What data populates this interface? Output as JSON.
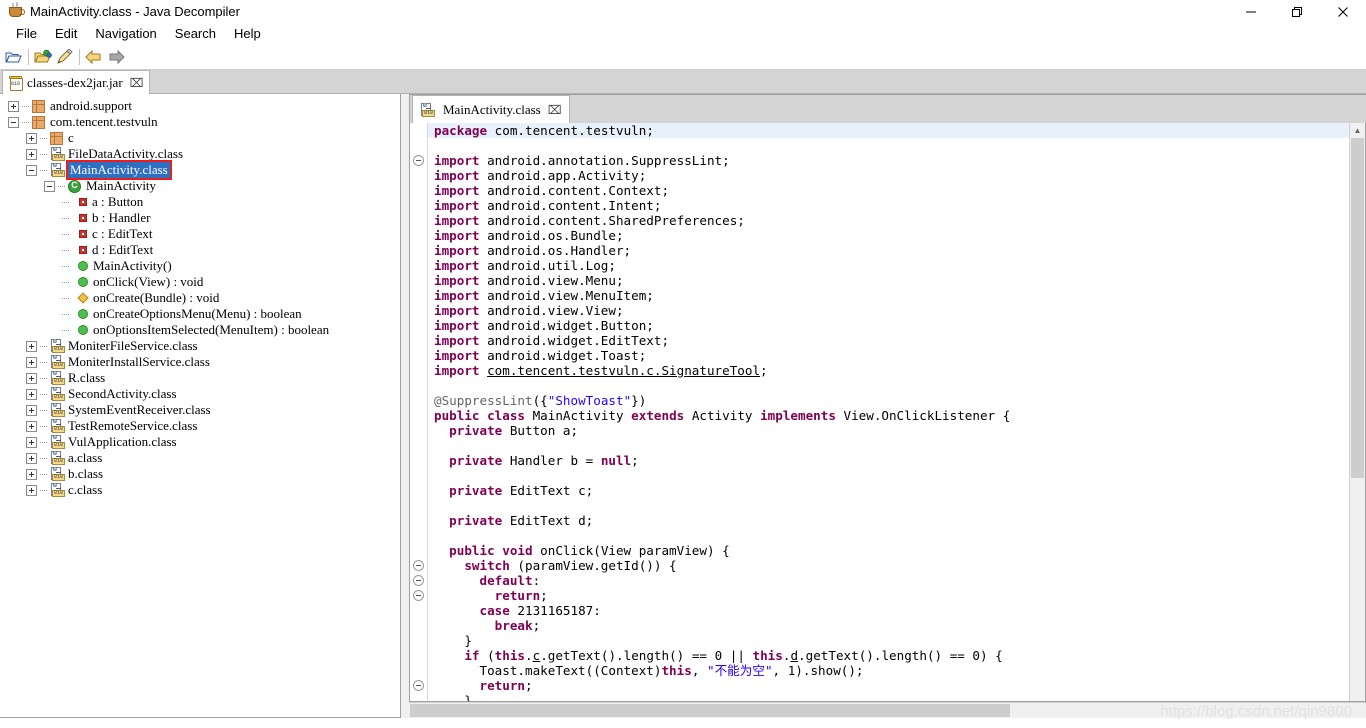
{
  "window": {
    "title": "MainActivity.class - Java Decompiler",
    "app_icon": "coffee-cup-icon",
    "minimize_label": "—",
    "maximize_label": "❐",
    "close_label": "✕"
  },
  "menu": {
    "items": [
      {
        "label": "File"
      },
      {
        "label": "Edit"
      },
      {
        "label": "Navigation"
      },
      {
        "label": "Search"
      },
      {
        "label": "Help"
      }
    ]
  },
  "toolbar": {
    "items": [
      {
        "name": "open-type-icon",
        "label": ""
      },
      {
        "name": "open-file-icon",
        "label": ""
      },
      {
        "name": "save-all-icon",
        "label": ""
      },
      {
        "name": "back-arrow-icon",
        "label": ""
      },
      {
        "name": "forward-arrow-icon",
        "label": ""
      }
    ]
  },
  "jar_tabs": [
    {
      "label": "classes-dex2jar.jar",
      "close": "⌧",
      "icon": "jar-icon",
      "active": true
    }
  ],
  "tree": [
    {
      "indent": 0,
      "toggle": "plus",
      "icon": "package",
      "label": "android.support"
    },
    {
      "indent": 0,
      "toggle": "minus",
      "icon": "package",
      "label": "com.tencent.testvuln"
    },
    {
      "indent": 1,
      "toggle": "plus",
      "icon": "package",
      "label": "c"
    },
    {
      "indent": 1,
      "toggle": "plus",
      "icon": "class",
      "label": "FileDataActivity.class"
    },
    {
      "indent": 1,
      "toggle": "minus",
      "icon": "class",
      "label": "MainActivity.class",
      "selected": true
    },
    {
      "indent": 2,
      "toggle": "minus",
      "icon": "type",
      "label": "MainActivity"
    },
    {
      "indent": 3,
      "toggle": "leaf",
      "icon": "field",
      "label": "a : Button"
    },
    {
      "indent": 3,
      "toggle": "leaf",
      "icon": "field",
      "label": "b : Handler"
    },
    {
      "indent": 3,
      "toggle": "leaf",
      "icon": "field",
      "label": "c : EditText"
    },
    {
      "indent": 3,
      "toggle": "leaf",
      "icon": "field",
      "label": "d : EditText"
    },
    {
      "indent": 3,
      "toggle": "leaf",
      "icon": "method",
      "label": "MainActivity()"
    },
    {
      "indent": 3,
      "toggle": "leaf",
      "icon": "method",
      "label": "onClick(View) : void"
    },
    {
      "indent": 3,
      "toggle": "leaf",
      "icon": "method-override",
      "label": "onCreate(Bundle) : void"
    },
    {
      "indent": 3,
      "toggle": "leaf",
      "icon": "method",
      "label": "onCreateOptionsMenu(Menu) : boolean"
    },
    {
      "indent": 3,
      "toggle": "leaf",
      "icon": "method",
      "label": "onOptionsItemSelected(MenuItem) : boolean"
    },
    {
      "indent": 1,
      "toggle": "plus",
      "icon": "class",
      "label": "MoniterFileService.class"
    },
    {
      "indent": 1,
      "toggle": "plus",
      "icon": "class",
      "label": "MoniterInstallService.class"
    },
    {
      "indent": 1,
      "toggle": "plus",
      "icon": "class",
      "label": "R.class"
    },
    {
      "indent": 1,
      "toggle": "plus",
      "icon": "class",
      "label": "SecondActivity.class"
    },
    {
      "indent": 1,
      "toggle": "plus",
      "icon": "class",
      "label": "SystemEventReceiver.class"
    },
    {
      "indent": 1,
      "toggle": "plus",
      "icon": "class",
      "label": "TestRemoteService.class"
    },
    {
      "indent": 1,
      "toggle": "plus",
      "icon": "class",
      "label": "VulApplication.class"
    },
    {
      "indent": 1,
      "toggle": "plus",
      "icon": "class",
      "label": "a.class"
    },
    {
      "indent": 1,
      "toggle": "plus",
      "icon": "class",
      "label": "b.class"
    },
    {
      "indent": 1,
      "toggle": "plus",
      "icon": "class",
      "label": "c.class"
    }
  ],
  "editor": {
    "tabs": [
      {
        "label": "MainActivity.class",
        "close": "⌧",
        "icon": "class-icon",
        "active": true
      }
    ],
    "highlight_line": 0,
    "fold_lines": [
      2,
      29,
      30,
      31,
      37
    ],
    "lines": [
      [
        {
          "t": "package ",
          "c": "kw"
        },
        {
          "t": "com.tencent.testvuln;",
          "c": ""
        }
      ],
      [],
      [
        {
          "t": "import ",
          "c": "kw"
        },
        {
          "t": "android.annotation.SuppressLint;",
          "c": ""
        }
      ],
      [
        {
          "t": "import ",
          "c": "kw"
        },
        {
          "t": "android.app.Activity;",
          "c": ""
        }
      ],
      [
        {
          "t": "import ",
          "c": "kw"
        },
        {
          "t": "android.content.Context;",
          "c": ""
        }
      ],
      [
        {
          "t": "import ",
          "c": "kw"
        },
        {
          "t": "android.content.Intent;",
          "c": ""
        }
      ],
      [
        {
          "t": "import ",
          "c": "kw"
        },
        {
          "t": "android.content.SharedPreferences;",
          "c": ""
        }
      ],
      [
        {
          "t": "import ",
          "c": "kw"
        },
        {
          "t": "android.os.Bundle;",
          "c": ""
        }
      ],
      [
        {
          "t": "import ",
          "c": "kw"
        },
        {
          "t": "android.os.Handler;",
          "c": ""
        }
      ],
      [
        {
          "t": "import ",
          "c": "kw"
        },
        {
          "t": "android.util.Log;",
          "c": ""
        }
      ],
      [
        {
          "t": "import ",
          "c": "kw"
        },
        {
          "t": "android.view.Menu;",
          "c": ""
        }
      ],
      [
        {
          "t": "import ",
          "c": "kw"
        },
        {
          "t": "android.view.MenuItem;",
          "c": ""
        }
      ],
      [
        {
          "t": "import ",
          "c": "kw"
        },
        {
          "t": "android.view.View;",
          "c": ""
        }
      ],
      [
        {
          "t": "import ",
          "c": "kw"
        },
        {
          "t": "android.widget.Button;",
          "c": ""
        }
      ],
      [
        {
          "t": "import ",
          "c": "kw"
        },
        {
          "t": "android.widget.EditText;",
          "c": ""
        }
      ],
      [
        {
          "t": "import ",
          "c": "kw"
        },
        {
          "t": "android.widget.Toast;",
          "c": ""
        }
      ],
      [
        {
          "t": "import ",
          "c": "kw"
        },
        {
          "t": "com.tencent.testvuln.c.SignatureTool",
          "c": "lnk"
        },
        {
          "t": ";",
          "c": ""
        }
      ],
      [],
      [
        {
          "t": "@SuppressLint",
          "c": "an"
        },
        {
          "t": "({",
          "c": ""
        },
        {
          "t": "\"ShowToast\"",
          "c": "str"
        },
        {
          "t": "})",
          "c": ""
        }
      ],
      [
        {
          "t": "public class ",
          "c": "kw"
        },
        {
          "t": "MainActivity ",
          "c": ""
        },
        {
          "t": "extends ",
          "c": "kw"
        },
        {
          "t": "Activity ",
          "c": ""
        },
        {
          "t": "implements ",
          "c": "kw"
        },
        {
          "t": "View.OnClickListener {",
          "c": ""
        }
      ],
      [
        {
          "t": "  private ",
          "c": "kw"
        },
        {
          "t": "Button a;",
          "c": ""
        }
      ],
      [],
      [
        {
          "t": "  private ",
          "c": "kw"
        },
        {
          "t": "Handler b = ",
          "c": ""
        },
        {
          "t": "null",
          "c": "kw"
        },
        {
          "t": ";",
          "c": ""
        }
      ],
      [],
      [
        {
          "t": "  private ",
          "c": "kw"
        },
        {
          "t": "EditText c;",
          "c": ""
        }
      ],
      [],
      [
        {
          "t": "  private ",
          "c": "kw"
        },
        {
          "t": "EditText d;",
          "c": ""
        }
      ],
      [],
      [
        {
          "t": "  public void ",
          "c": "kw"
        },
        {
          "t": "onClick(View paramView) {",
          "c": ""
        }
      ],
      [
        {
          "t": "    switch ",
          "c": "kw"
        },
        {
          "t": "(paramView.getId()) {",
          "c": ""
        }
      ],
      [
        {
          "t": "      default",
          "c": "kw"
        },
        {
          "t": ":",
          "c": ""
        }
      ],
      [
        {
          "t": "        return",
          "c": "kw"
        },
        {
          "t": ";",
          "c": ""
        }
      ],
      [
        {
          "t": "      case ",
          "c": "kw"
        },
        {
          "t": "2131165187:",
          "c": ""
        }
      ],
      [
        {
          "t": "        break",
          "c": "kw"
        },
        {
          "t": ";",
          "c": ""
        }
      ],
      [
        {
          "t": "    }",
          "c": ""
        }
      ],
      [
        {
          "t": "    if ",
          "c": "kw"
        },
        {
          "t": "(",
          "c": ""
        },
        {
          "t": "this",
          "c": "kw"
        },
        {
          "t": ".",
          "c": ""
        },
        {
          "t": "c",
          "c": "fld"
        },
        {
          "t": ".getText().length() == 0 || ",
          "c": ""
        },
        {
          "t": "this",
          "c": "kw"
        },
        {
          "t": ".",
          "c": ""
        },
        {
          "t": "d",
          "c": "fld"
        },
        {
          "t": ".getText().length() == 0) {",
          "c": ""
        }
      ],
      [
        {
          "t": "      Toast.makeText((Context)",
          "c": ""
        },
        {
          "t": "this",
          "c": "kw"
        },
        {
          "t": ", ",
          "c": ""
        },
        {
          "t": "\"不能为空\"",
          "c": "str"
        },
        {
          "t": ", 1).show();",
          "c": ""
        }
      ],
      [
        {
          "t": "      return",
          "c": "kw"
        },
        {
          "t": ";",
          "c": ""
        }
      ],
      [
        {
          "t": "    }",
          "c": ""
        }
      ]
    ]
  },
  "scrollbars": {
    "editor_vertical": {
      "up_arrow": "▲",
      "down_arrow": "▼"
    },
    "editor_horizontal": {
      "left_arrow": "◀",
      "right_arrow": "▶"
    }
  },
  "watermark": {
    "text": "https://blog.csdn.net/qin9800"
  },
  "colors": {
    "selection_blue": "#2f6fc0",
    "selection_outline_red": "#ee1c1c",
    "keyword_purple": "#7f0055",
    "string_blue": "#2a00ff",
    "annotation_gray": "#646464",
    "current_line": "#e8f0fb",
    "tabstrip_gray": "#d4d4d4"
  }
}
